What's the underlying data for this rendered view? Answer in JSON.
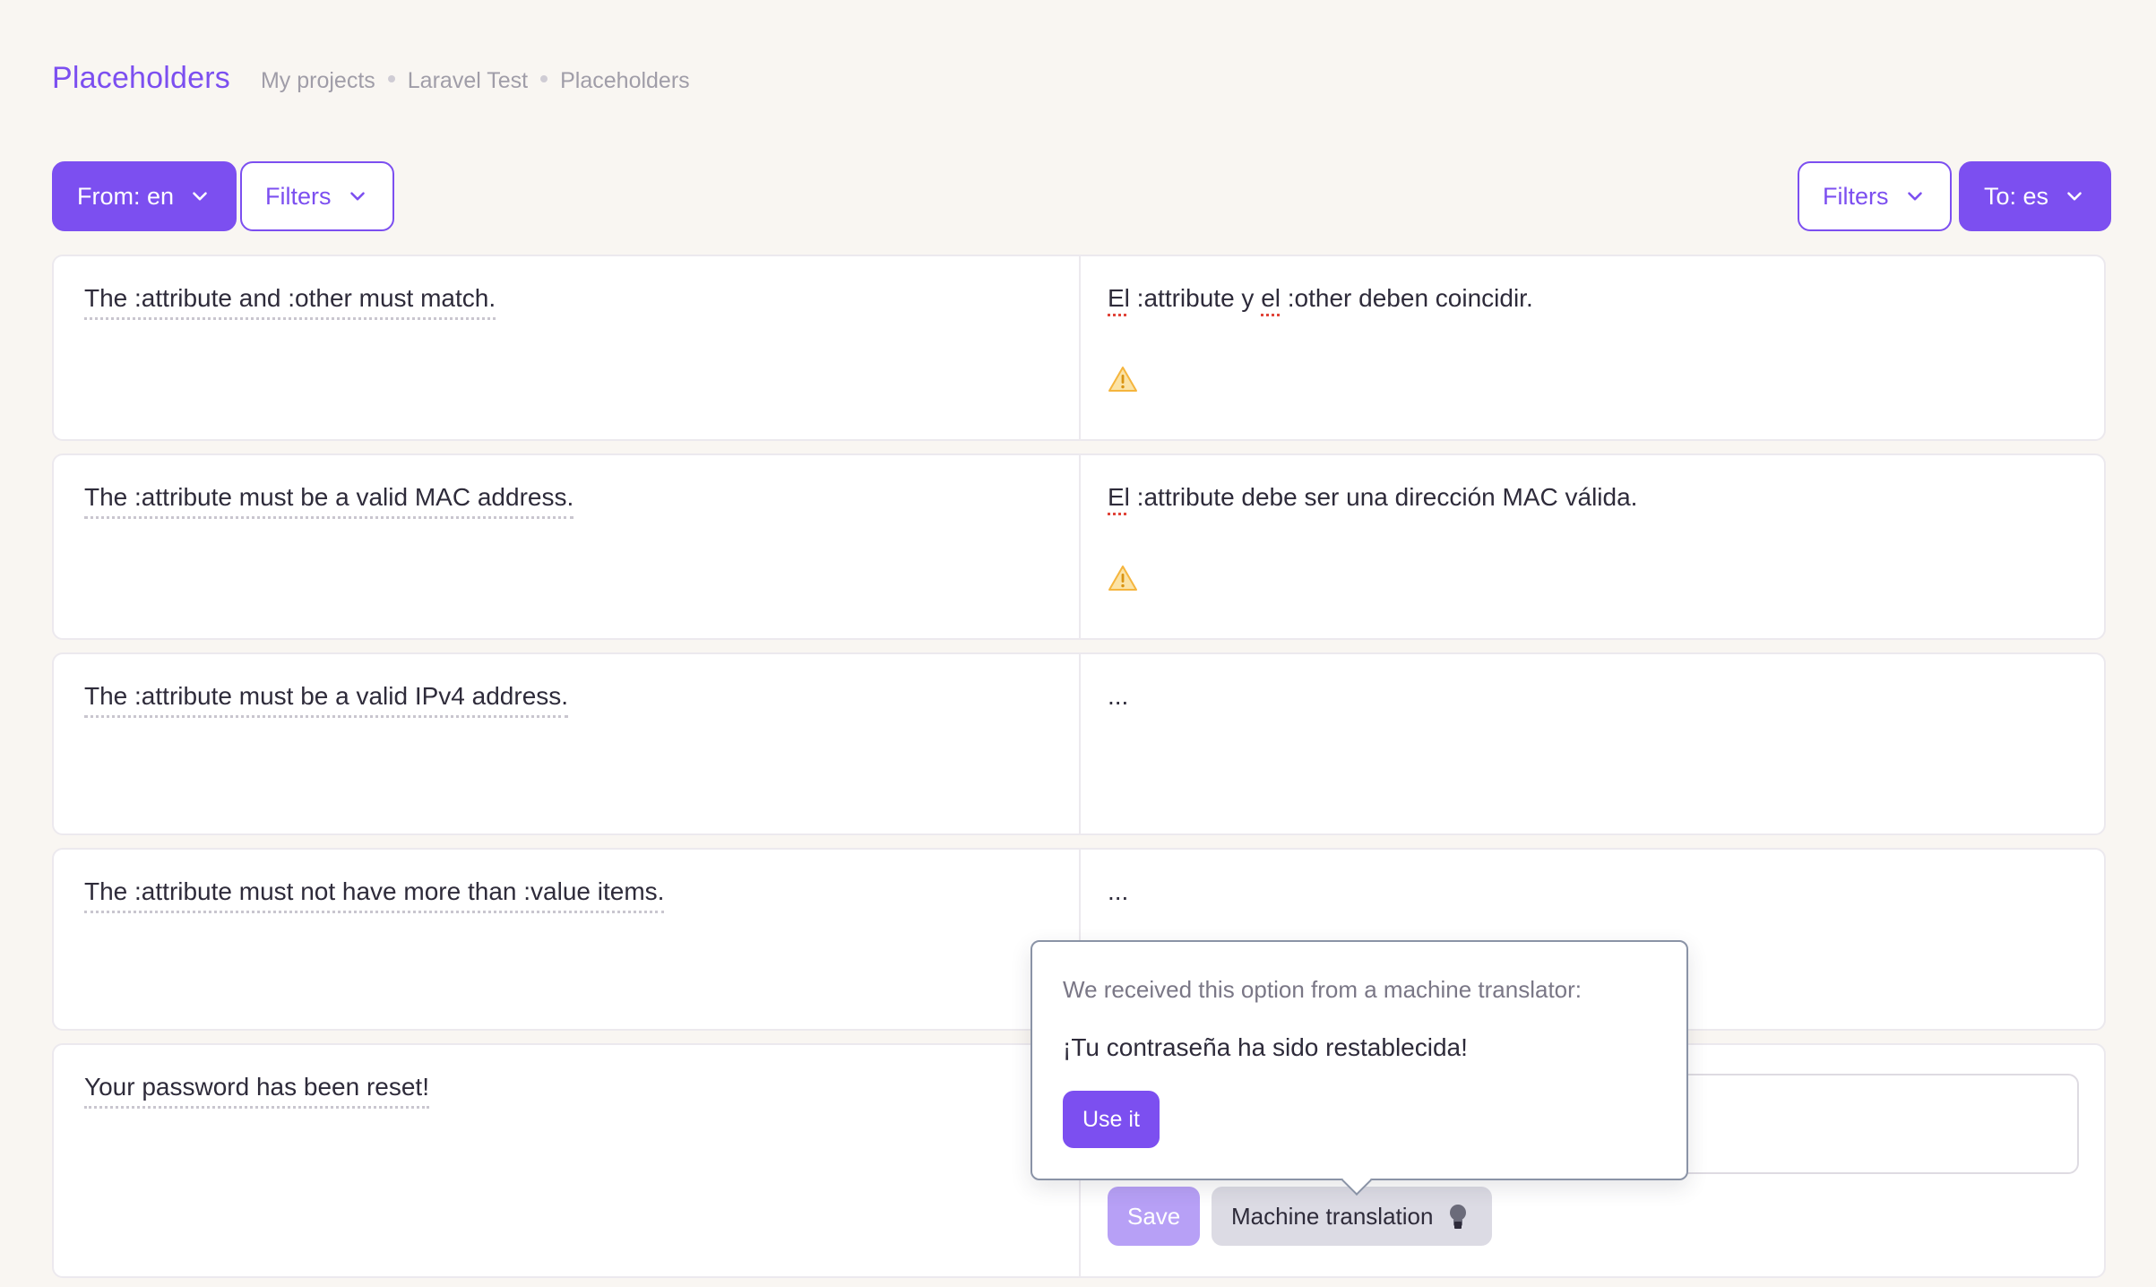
{
  "header": {
    "title": "Placeholders",
    "breadcrumb": [
      "My projects",
      "Laravel Test",
      "Placeholders"
    ]
  },
  "toolbar": {
    "from_label": "From: en",
    "left_filters_label": "Filters",
    "right_filters_label": "Filters",
    "to_label": "To: es"
  },
  "rows": [
    {
      "source": "The :attribute and :other must match.",
      "target_parts": [
        "El",
        " :attribute y ",
        "el",
        " :other deben coincidir."
      ],
      "warning": true
    },
    {
      "source": "The :attribute must be a valid MAC address.",
      "target_parts": [
        "El",
        " :attribute debe ser una dirección MAC válida."
      ],
      "warning": true
    },
    {
      "source": "The :attribute must be a valid IPv4 address.",
      "target": "..."
    },
    {
      "source": "The :attribute must not have more than :value items.",
      "target": "..."
    },
    {
      "source": "Your password has been reset!",
      "editing": true,
      "save_label": "Save",
      "machine_translation_label": "Machine translation"
    }
  ],
  "popover": {
    "label": "We received this option from a machine translator:",
    "value": "¡Tu contraseña ha sido restablecida!",
    "use_label": "Use it"
  },
  "icons": {
    "dropdown": "chevron-down-icon",
    "warning": "warning-icon",
    "machine_translation": "lightbulb-icon"
  },
  "colors": {
    "accent": "#7c4ff0",
    "save_disabled": "#b7a0f6",
    "warning": "#f5b53d",
    "error_underline": "#e0443a",
    "background": "#f9f6f2"
  }
}
